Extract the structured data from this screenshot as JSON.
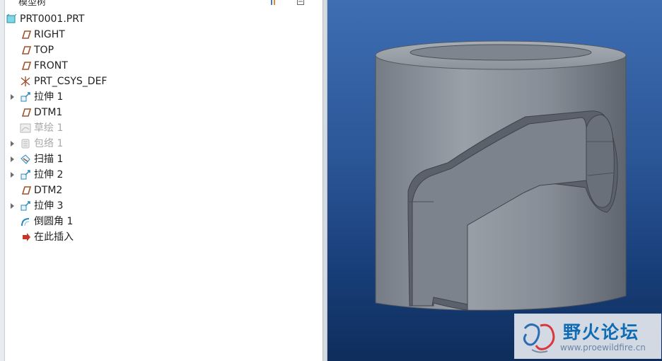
{
  "panel": {
    "title": "模型树"
  },
  "tree": {
    "root": {
      "label": "PRT0001.PRT",
      "icon": "part-icon"
    },
    "items": [
      {
        "label": "RIGHT",
        "icon": "datum-plane-icon",
        "expandable": false,
        "disabled": false
      },
      {
        "label": "TOP",
        "icon": "datum-plane-icon",
        "expandable": false,
        "disabled": false
      },
      {
        "label": "FRONT",
        "icon": "datum-plane-icon",
        "expandable": false,
        "disabled": false
      },
      {
        "label": "PRT_CSYS_DEF",
        "icon": "coordinate-system-icon",
        "expandable": false,
        "disabled": false
      },
      {
        "label": "拉伸 1",
        "icon": "extrude-icon",
        "expandable": true,
        "disabled": false
      },
      {
        "label": "DTM1",
        "icon": "datum-plane-icon",
        "expandable": false,
        "disabled": false
      },
      {
        "label": "草绘 1",
        "icon": "sketch-icon",
        "expandable": false,
        "disabled": true
      },
      {
        "label": "包络 1",
        "icon": "wrap-icon",
        "expandable": true,
        "disabled": true
      },
      {
        "label": "扫描 1",
        "icon": "sweep-icon",
        "expandable": true,
        "disabled": false
      },
      {
        "label": "拉伸 2",
        "icon": "extrude-icon",
        "expandable": true,
        "disabled": false
      },
      {
        "label": "DTM2",
        "icon": "datum-plane-icon",
        "expandable": false,
        "disabled": false
      },
      {
        "label": "拉伸 3",
        "icon": "extrude-icon",
        "expandable": true,
        "disabled": false
      },
      {
        "label": "倒圆角 1",
        "icon": "round-icon",
        "expandable": false,
        "disabled": false
      },
      {
        "label": "在此插入",
        "icon": "insert-here-arrow-icon",
        "expandable": false,
        "disabled": false
      }
    ]
  },
  "colors": {
    "datum": "#a0522d",
    "feature": "#2e8ab8",
    "insert": "#c0392b",
    "viewport_top": "#3f6eb3",
    "viewport_bottom": "#0e2d5c"
  },
  "watermark": {
    "title": "野火论坛",
    "url": "www.proewildfire.cn"
  }
}
